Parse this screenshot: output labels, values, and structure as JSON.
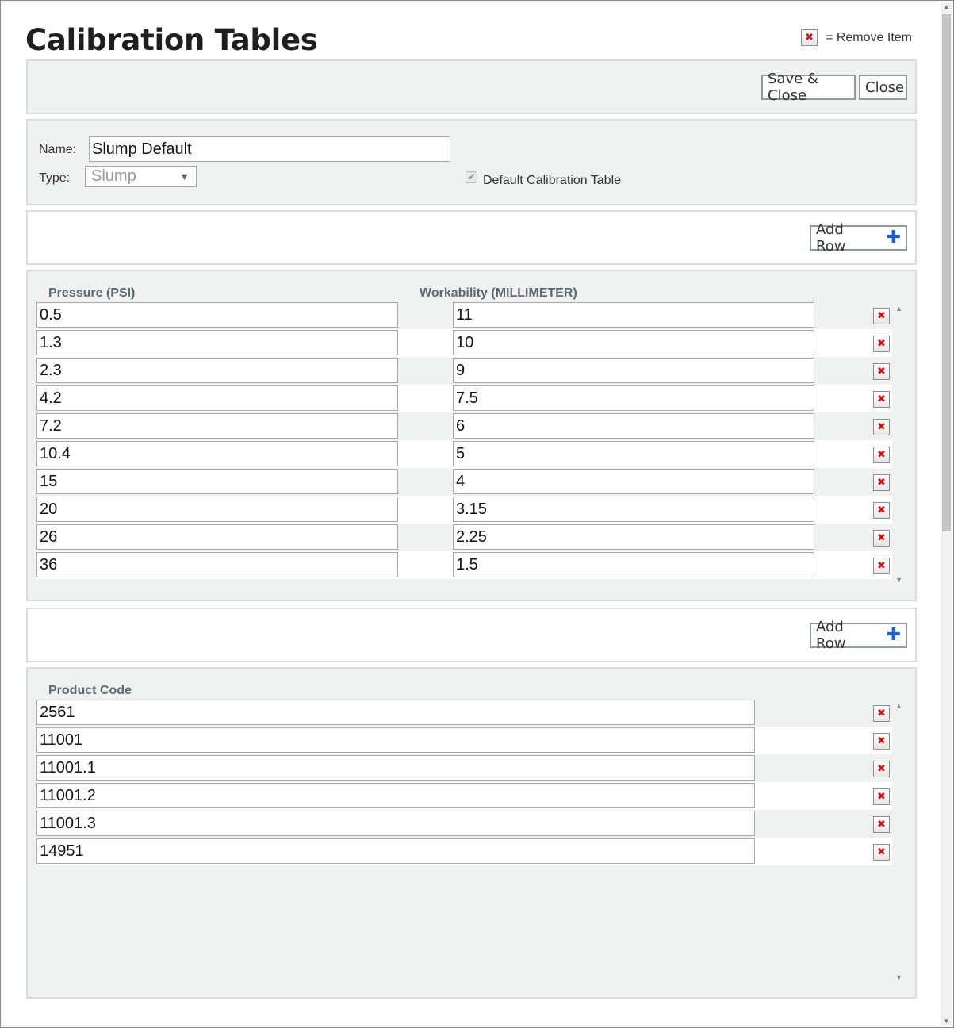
{
  "header": {
    "title": "Calibration Tables",
    "legend_text": "= Remove Item"
  },
  "toolbar": {
    "save_close_label": "Save & Close",
    "close_label": "Close"
  },
  "form": {
    "name_label": "Name:",
    "name_value": "Slump Default",
    "type_label": "Type:",
    "type_value": "Slump",
    "default_label": "Default Calibration Table",
    "default_checked": true
  },
  "calibration": {
    "add_row_label": "Add Row",
    "col_pressure": "Pressure (PSI)",
    "col_workability": "Workability (MILLIMETER)",
    "rows": [
      {
        "pressure": "0.5",
        "workability": "11"
      },
      {
        "pressure": "1.3",
        "workability": "10"
      },
      {
        "pressure": "2.3",
        "workability": "9"
      },
      {
        "pressure": "4.2",
        "workability": "7.5"
      },
      {
        "pressure": "7.2",
        "workability": "6"
      },
      {
        "pressure": "10.4",
        "workability": "5"
      },
      {
        "pressure": "15",
        "workability": "4"
      },
      {
        "pressure": "20",
        "workability": "3.15"
      },
      {
        "pressure": "26",
        "workability": "2.25"
      },
      {
        "pressure": "36",
        "workability": "1.5"
      }
    ]
  },
  "products": {
    "add_row_label": "Add Row",
    "col_product_code": "Product Code",
    "rows": [
      "2561",
      "11001",
      "11001.1",
      "11001.2",
      "11001.3",
      "14951"
    ]
  },
  "icons": {
    "remove": "remove-x-icon",
    "add": "plus-icon",
    "dropdown": "triangle-down-icon",
    "check": "check-icon"
  },
  "colors": {
    "remove_icon": "#c01818",
    "plus_icon": "#1d5fcf",
    "panel_bg": "#f0f2f2",
    "header_text": "#5a6b73"
  }
}
